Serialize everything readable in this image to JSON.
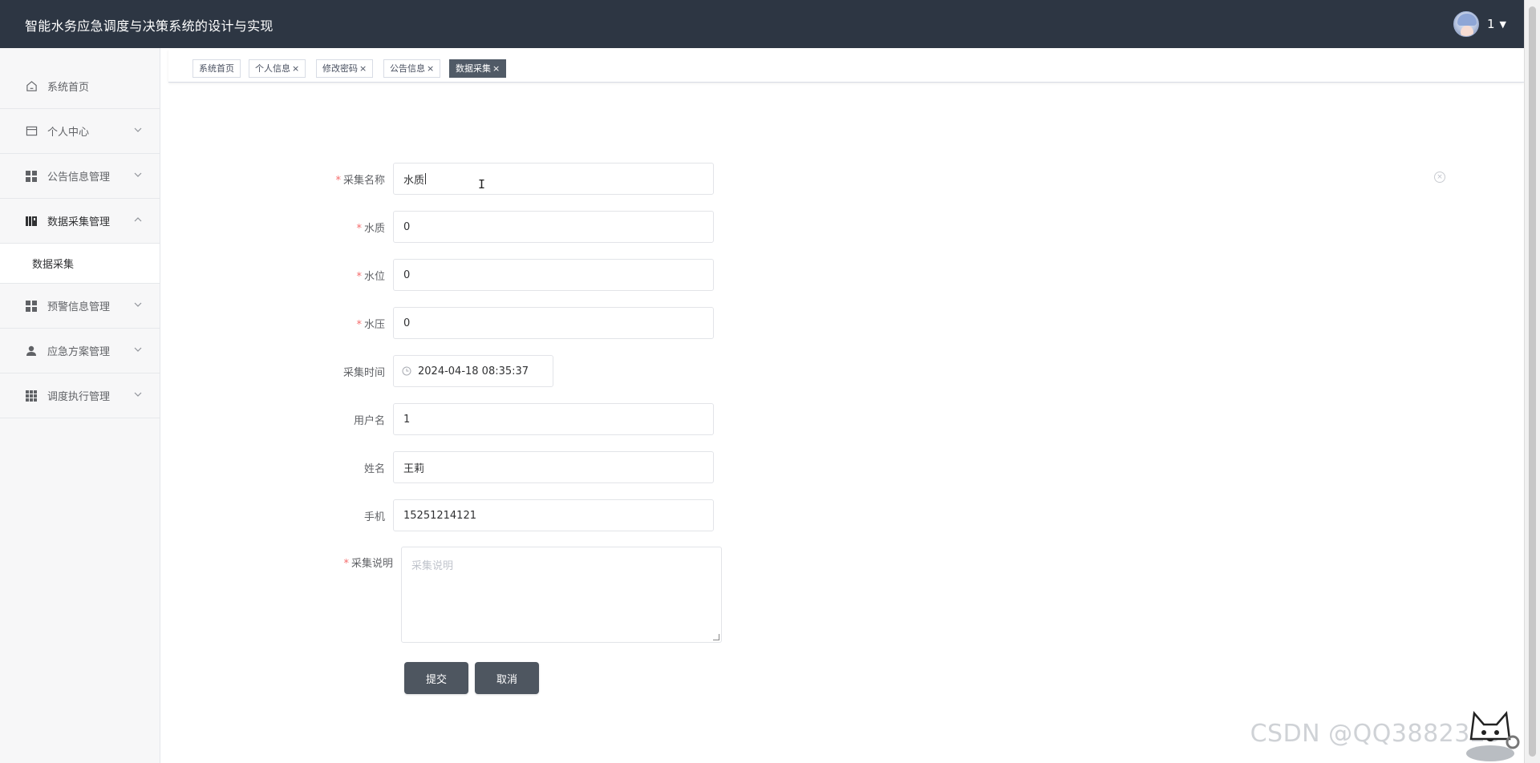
{
  "header": {
    "title": "智能水务应急调度与决策系统的设计与实现",
    "user_name": "1"
  },
  "sidebar": {
    "items": [
      {
        "label": "系统首页",
        "icon": "home-icon"
      },
      {
        "label": "个人中心",
        "icon": "user-card-icon"
      },
      {
        "label": "公告信息管理",
        "icon": "grid-icon"
      },
      {
        "label": "数据采集管理",
        "icon": "book-icon",
        "open": true
      },
      {
        "label": "预警信息管理",
        "icon": "grid-icon"
      },
      {
        "label": "应急方案管理",
        "icon": "person-icon"
      },
      {
        "label": "调度执行管理",
        "icon": "apps-icon"
      }
    ],
    "submenu": {
      "label": "数据采集"
    }
  },
  "tabs": [
    {
      "label": "系统首页",
      "closable": false
    },
    {
      "label": "个人信息",
      "closable": true
    },
    {
      "label": "修改密码",
      "closable": true
    },
    {
      "label": "公告信息",
      "closable": true
    },
    {
      "label": "数据采集",
      "closable": true,
      "active": true
    }
  ],
  "tab_close_glyph": "×",
  "form": {
    "fields": [
      {
        "label": "采集名称",
        "required": true,
        "value": "水质"
      },
      {
        "label": "水质",
        "required": true,
        "value": "0"
      },
      {
        "label": "水位",
        "required": true,
        "value": "0"
      },
      {
        "label": "水压",
        "required": true,
        "value": "0"
      },
      {
        "label": "采集时间",
        "required": false,
        "value": "2024-04-18 08:35:37"
      },
      {
        "label": "用户名",
        "required": false,
        "value": "1"
      },
      {
        "label": "姓名",
        "required": false,
        "value": "王莉"
      },
      {
        "label": "手机",
        "required": false,
        "value": "15251214121"
      }
    ],
    "description": {
      "label": "采集说明",
      "required": true,
      "placeholder": "采集说明"
    },
    "required_mark": "*",
    "submit_label": "提交",
    "cancel_label": "取消"
  },
  "watermark": "CSDN @QQ3882323",
  "colors": {
    "header_bg": "#2d3643",
    "active_tab": "#505a66",
    "button": "#4e5660",
    "required": "#f56c6c"
  }
}
